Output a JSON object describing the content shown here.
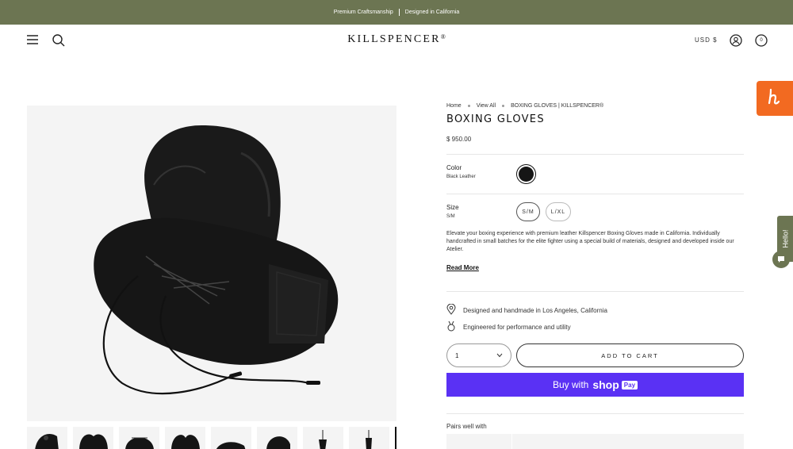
{
  "announcement": {
    "left": "Premium Craftsmanship",
    "right": "Designed in California"
  },
  "header": {
    "logo": "KILLSPENCER",
    "logo_mark": "®",
    "currency": "USD $",
    "cart_count": "0"
  },
  "breadcrumb": {
    "items": [
      "Home",
      "View All",
      "BOXING GLOVES | KILLSPENCER®"
    ]
  },
  "product": {
    "title": "BOXING GLOVES",
    "price": "$ 950.00",
    "color_label": "Color",
    "color_value": "Black Leather",
    "size_label": "Size",
    "size_value": "S/M",
    "sizes": [
      "S/M",
      "L/XL"
    ],
    "description": "Elevate your boxing experience with premium leather Killspencer Boxing Gloves made in California. Individually handcrafted in small batches for the elite fighter using a special build of materials, designed and developed inside our Atelier.",
    "read_more": "Read More",
    "features": [
      "Designed and handmade in Los Angeles, California",
      "Engineered for performance and utility"
    ],
    "quantity": "1",
    "add_to_cart": "ADD TO CART",
    "buy_with": "Buy with",
    "shop": "shop",
    "pay": "Pay",
    "pairs_label": "Pairs well with"
  },
  "widgets": {
    "hello_tab": "Hello!"
  },
  "colors": {
    "announcement_bg": "#6c7552",
    "shop_pay": "#5a31f4",
    "h_badge": "#f26a21"
  },
  "icons": [
    "menu-icon",
    "search-icon",
    "account-icon",
    "cart-icon",
    "location-pin-icon",
    "medal-icon",
    "chevron-down-icon",
    "h-logo-icon",
    "chat-icon"
  ]
}
